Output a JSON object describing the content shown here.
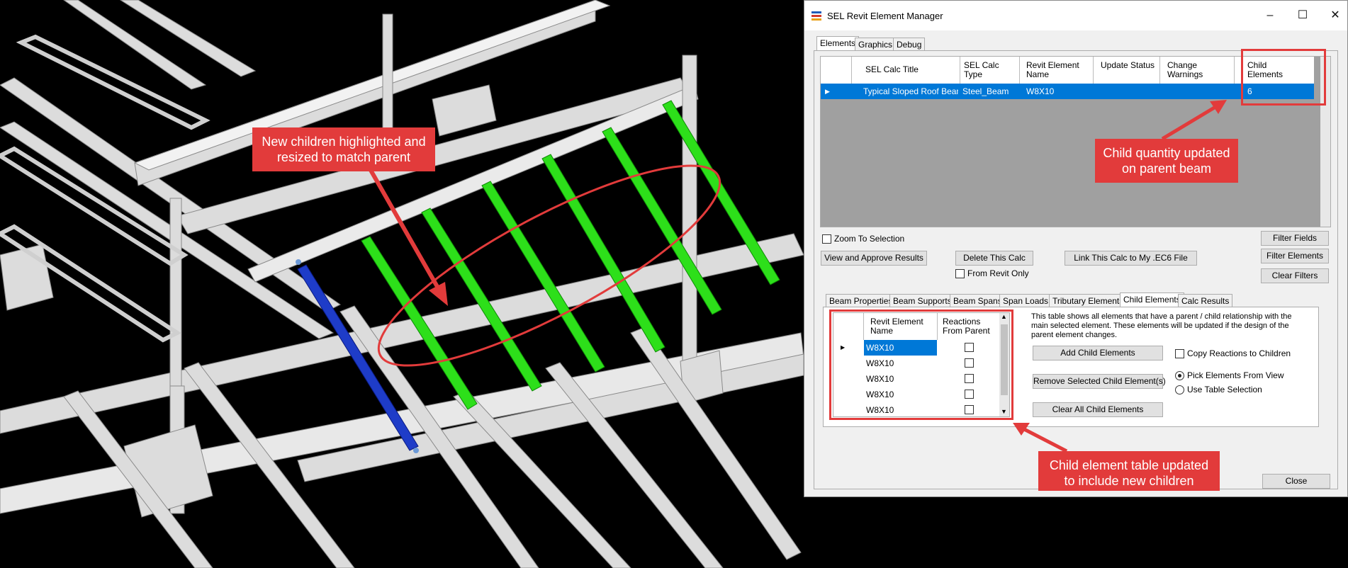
{
  "window": {
    "title": "SEL Revit Element Manager",
    "minimize": "–",
    "maximize": "☐",
    "close": "✕"
  },
  "main_tabs": [
    "Elements",
    "Graphics",
    "Debug"
  ],
  "grid": {
    "headers": [
      "SEL Calc Title",
      "SEL Calc Type",
      "Revit Element Name",
      "Update Status",
      "Change Warnings",
      "Child Elements"
    ],
    "row": {
      "title": "Typical Sloped Roof Beam",
      "type": "Steel_Beam",
      "name": "W8X10",
      "status": "",
      "warnings": "",
      "children": "6"
    }
  },
  "controls": {
    "zoom_to_selection": "Zoom To Selection",
    "filter_fields": "Filter Fields",
    "view_approve": "View and Approve Results",
    "delete_calc": "Delete This Calc",
    "link_calc": "Link This Calc to My .EC6 File",
    "filter_elements": "Filter Elements",
    "from_revit_only": "From Revit Only",
    "clear_filters": "Clear Filters",
    "close": "Close"
  },
  "sub_tabs": [
    "Beam Properties",
    "Beam Supports",
    "Beam Spans",
    "Span Loads",
    "Tributary Elements",
    "Child Elements",
    "Calc Results"
  ],
  "child_table": {
    "headers": [
      "Revit Element Name",
      "Reactions From Parent"
    ],
    "rows": [
      "W8X10",
      "W8X10",
      "W8X10",
      "W8X10",
      "W8X10"
    ]
  },
  "child_panel": {
    "description": "This table shows all elements that have a parent / child relationship with the main selected element.  These elements will be updated if the design of the parent element changes.",
    "add": "Add Child Elements",
    "copy_reactions": "Copy Reactions to Children",
    "remove": "Remove Selected Child Element(s)",
    "pick_from_view": "Pick Elements From View",
    "use_table": "Use Table Selection",
    "clear_all": "Clear All Child Elements"
  },
  "callouts": {
    "viewport": "New children highlighted and resized to match parent",
    "quantity": "Child quantity updated on parent beam",
    "table": "Child element table updated to include new children"
  },
  "colors": {
    "accent_red": "#e23b3b",
    "selection_blue": "#0078d7",
    "child_green": "#2ddf1a",
    "parent_blue": "#1e3cc8"
  }
}
